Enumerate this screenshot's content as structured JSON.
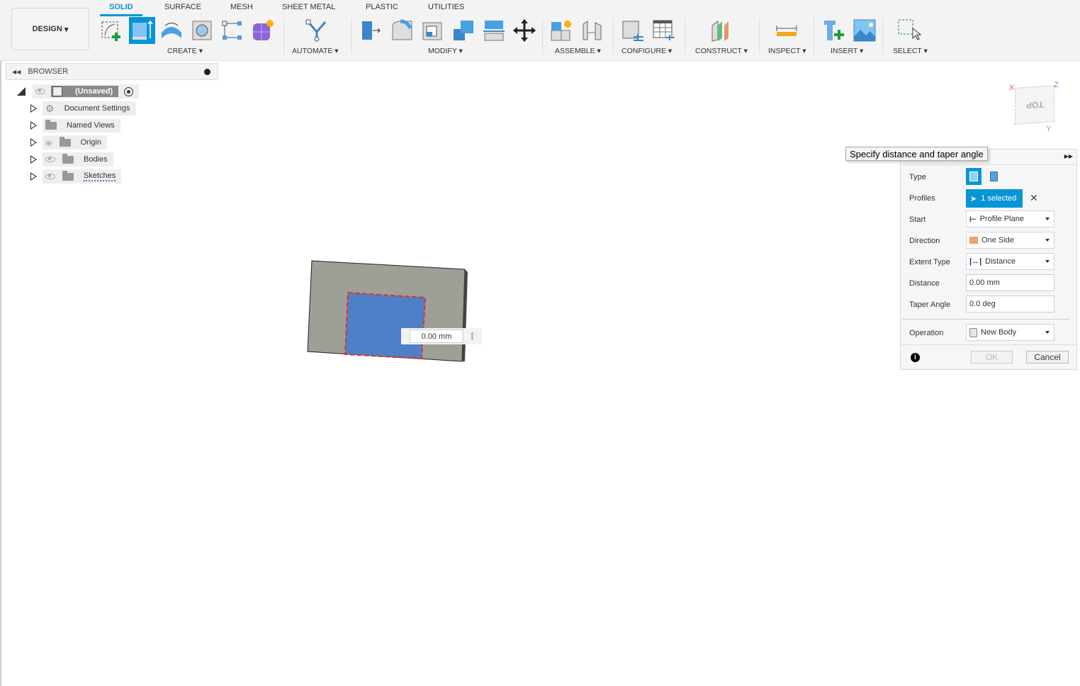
{
  "toolbar": {
    "workspace": "DESIGN",
    "tabs": [
      {
        "label": "SOLID",
        "active": true
      },
      {
        "label": "SURFACE"
      },
      {
        "label": "MESH"
      },
      {
        "label": "SHEET METAL"
      },
      {
        "label": "PLASTIC"
      },
      {
        "label": "UTILITIES"
      }
    ],
    "groups": [
      "CREATE ▾",
      "AUTOMATE ▾",
      "MODIFY ▾",
      "ASSEMBLE ▾",
      "CONFIGURE ▾",
      "CONSTRUCT ▾",
      "INSPECT ▾",
      "INSERT ▾",
      "SELECT ▾"
    ],
    "accent": "#0696d7"
  },
  "browser": {
    "title": "BROWSER",
    "root": "(Unsaved)",
    "items": [
      "Document Settings",
      "Named Views",
      "Origin",
      "Bodies",
      "Sketches"
    ]
  },
  "viewport": {
    "dimension_input": "0.00 mm",
    "viewcube_face": "TOP",
    "axes": [
      "X",
      "Y",
      "Z"
    ]
  },
  "tooltip": "Specify distance and taper angle",
  "extrude_panel": {
    "labels": {
      "type": "Type",
      "profiles": "Profiles",
      "start": "Start",
      "direction": "Direction",
      "extent": "Extent Type",
      "distance": "Distance",
      "taper": "Taper Angle",
      "operation": "Operation"
    },
    "profiles_value": "1 selected",
    "start_value": "Profile Plane",
    "direction_value": "One Side",
    "extent_value": "Distance",
    "distance_value": "0.00 mm",
    "taper_value": "0.0 deg",
    "operation_value": "New Body",
    "ok": "OK",
    "cancel": "Cancel"
  }
}
